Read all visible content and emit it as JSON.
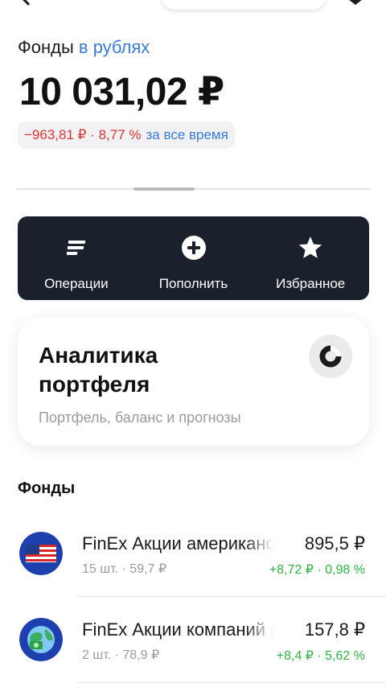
{
  "header": {
    "title_main": "Фонды",
    "title_currency": "в рублях"
  },
  "balance": {
    "value": "10 031,02 ₽",
    "change_value": "−963,81 ₽ · 8,77 %",
    "change_period": "за все время"
  },
  "actions": [
    {
      "label": "Операции",
      "icon": "operations-icon"
    },
    {
      "label": "Пополнить",
      "icon": "plus-circle-icon"
    },
    {
      "label": "Избранное",
      "icon": "star-icon"
    }
  ],
  "analytics": {
    "title": "Аналитика портфеля",
    "subtitle": "Портфель, баланс и прогнозы",
    "icon": "donut-chart-icon"
  },
  "funds_section": {
    "title": "Фонды",
    "items": [
      {
        "name": "FinEx Акции американских компаний",
        "quantity": "15 шт. · 59,7 ₽",
        "price": "895,5 ₽",
        "gain": "+8,72 ₽ · 0,98 %",
        "icon": "usa-flag-icon"
      },
      {
        "name": "FinEx Акции компаний развивающихся стран",
        "quantity": "2 шт. · 78,9 ₽",
        "price": "157,8 ₽",
        "gain": "+8,4 ₽ · 5,62 %",
        "icon": "globe-icon"
      }
    ]
  },
  "colors": {
    "accent": "#3a7bd5",
    "negative": "#e03131",
    "positive": "#2fb344",
    "action_bar": "#1a202c"
  }
}
